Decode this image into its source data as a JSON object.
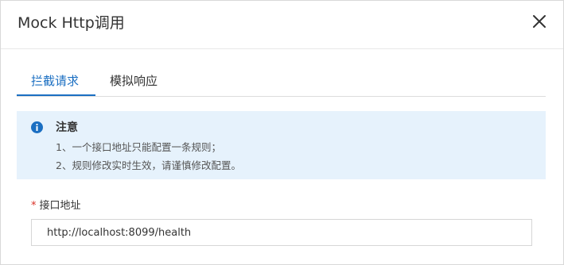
{
  "dialog": {
    "title": "Mock Http调用"
  },
  "tabs": [
    {
      "label": "拦截请求",
      "active": true
    },
    {
      "label": "模拟响应",
      "active": false
    }
  ],
  "notice": {
    "icon": "info-icon",
    "title": "注意",
    "lines": [
      "1、一个接口地址只能配置一条规则；",
      "2、规则修改实时生效，请谨慎修改配置。"
    ]
  },
  "form": {
    "url_field": {
      "required_mark": "*",
      "label": "接口地址",
      "value": "http://localhost:8099/health"
    }
  },
  "colors": {
    "accent": "#1b6fc2",
    "notice_bg": "#e6f2fc",
    "required": "#d93026"
  }
}
